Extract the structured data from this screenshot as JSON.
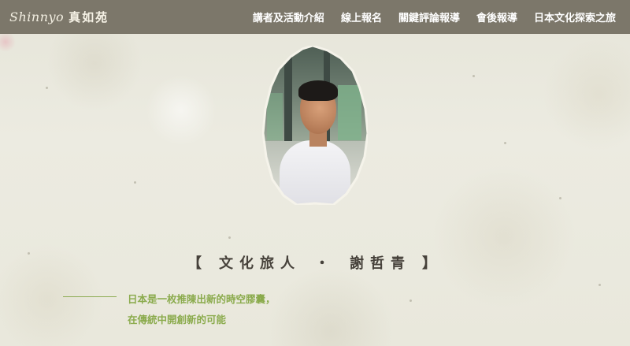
{
  "header": {
    "logo_script": "Shinnyo",
    "logo_cjk": "真如苑",
    "nav": [
      {
        "label": "講者及活動介紹"
      },
      {
        "label": "線上報名"
      },
      {
        "label": "關鍵評論報導"
      },
      {
        "label": "會後報導"
      },
      {
        "label": "日本文化探索之旅"
      }
    ]
  },
  "hero": {
    "open_bracket": "【",
    "title_left": "文化旅人",
    "separator": "・",
    "title_right": "謝哲青",
    "close_bracket": "】"
  },
  "quote": {
    "line1": "日本是一枚推陳出新的時空膠囊，",
    "line2": "在傳統中開創新的可能"
  },
  "colors": {
    "header_bg": "#7c776a",
    "accent_green": "#8bab4d",
    "title_text": "#46413a",
    "paper": "#ecebe0"
  }
}
